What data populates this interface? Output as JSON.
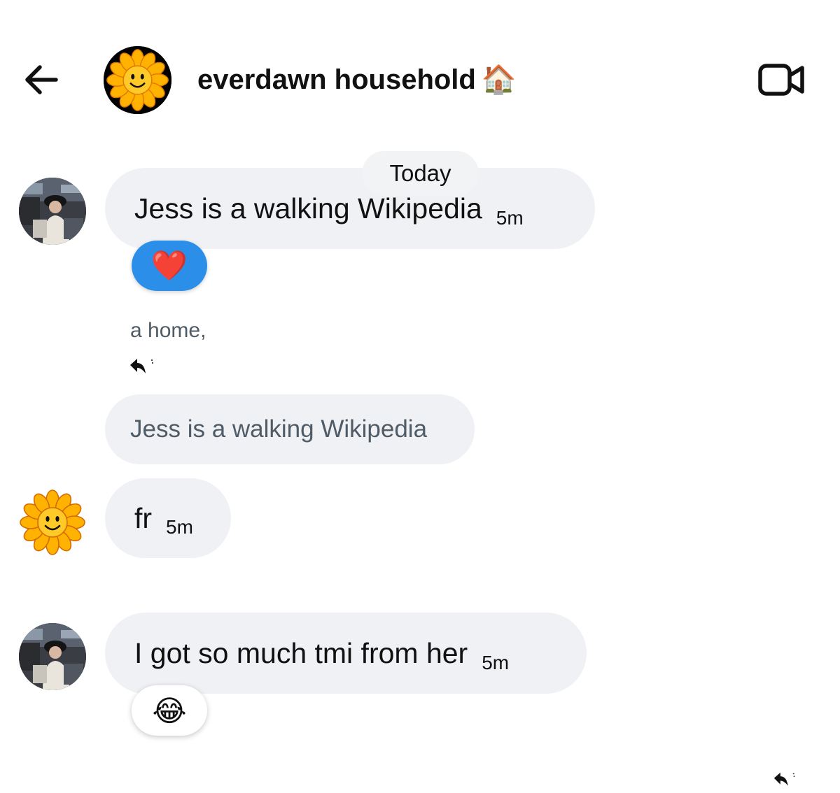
{
  "header": {
    "title": "everdawn household",
    "title_emoji": "🏠",
    "back_icon": "arrow-left-icon",
    "video_icon": "video-camera-icon"
  },
  "date_divider": "Today",
  "messages": [
    {
      "text": "Jess is a walking Wikipedia",
      "time": "5m",
      "reaction": "❤️"
    },
    {
      "text": "fr",
      "time": "5m"
    },
    {
      "text": "I got so much tmi from her",
      "time": "5m",
      "reaction": "😂"
    }
  ],
  "reply": {
    "label": "a home,",
    "quoted_text": "Jess is a walking Wikipedia",
    "icon": "reply-icon"
  },
  "colors": {
    "bubble_bg": "#eff1f4",
    "heart_reaction_bg": "#2b8ee8",
    "muted_text": "#4f5b66"
  }
}
